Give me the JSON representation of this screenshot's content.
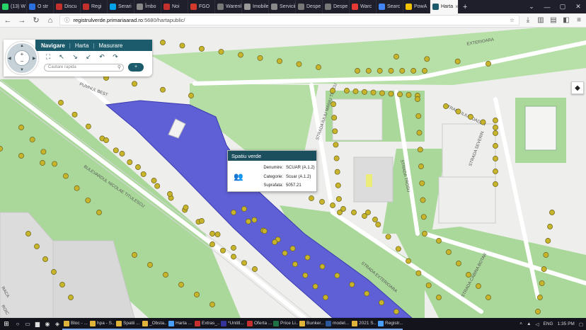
{
  "browser": {
    "tabs": [
      {
        "label": "(13) W",
        "color": "#25d366",
        "icon": "whatsapp-icon"
      },
      {
        "label": "O str",
        "color": "#2a6fdb",
        "icon": "site-icon"
      },
      {
        "label": "Discu",
        "color": "#c4302b",
        "icon": "youtube-icon"
      },
      {
        "label": "Regi",
        "color": "#c4302b",
        "icon": "site-icon"
      },
      {
        "label": "Serari",
        "color": "#00a2e8",
        "icon": "site-icon"
      },
      {
        "label": "Îmbo",
        "color": "#888888",
        "icon": "site-icon"
      },
      {
        "label": "Noi",
        "color": "#c4302b",
        "icon": "site-icon"
      },
      {
        "label": "FGO",
        "color": "#d33a2c",
        "icon": "site-icon"
      },
      {
        "label": "Warenko",
        "color": "#777777",
        "icon": "site-icon"
      },
      {
        "label": "Imobile",
        "color": "#999999",
        "icon": "site-icon"
      },
      {
        "label": "Servicii",
        "color": "#888888",
        "icon": "site-icon"
      },
      {
        "label": "Despe",
        "color": "#777777",
        "icon": "site-icon"
      },
      {
        "label": "Despe",
        "color": "#777777",
        "icon": "site-icon"
      },
      {
        "label": "Warc",
        "color": "#e53935",
        "icon": "site-icon"
      },
      {
        "label": "Searc",
        "color": "#4285f4",
        "icon": "google-icon"
      },
      {
        "label": "PowA",
        "color": "#f2c200",
        "icon": "site-icon"
      },
      {
        "label": "Harta",
        "color": "#1b5b6c",
        "icon": "site-icon",
        "active": true
      }
    ],
    "url_host": "registrulverde.primariaarad.ro",
    "url_path": ":5680/hartapublic/"
  },
  "nav_panel": {
    "tabs": [
      "Navigare",
      "Harta",
      "Masurare"
    ],
    "active_tab": "Navigare",
    "search_placeholder": "Cautare rapida",
    "go_label": "+"
  },
  "map": {
    "street_labels": [
      "BULEVARDUL NICOLAE TITULESCU",
      "STRADA EXTERIOARA",
      "STRADA ILIU YOADER",
      "STRADA TROSU",
      "STRADA SEVERIN",
      "STRADA CABINA BOTAR",
      "STRADA IULIU MANIU TESCU",
      "PUMNUL BEST",
      "EXTERIOARA",
      "RACA",
      "ROIC"
    ]
  },
  "popup": {
    "title": "Spatiu verde",
    "rows": [
      {
        "key": "Denumire:",
        "value": "SCUAR (A.1.2)"
      },
      {
        "key": "Categorie:",
        "value": "Scuar (A.1.2)"
      },
      {
        "key": "Suprafata:",
        "value": "5057.21"
      }
    ]
  },
  "taskbar": {
    "items": [
      {
        "label": "Bloc - ...",
        "color": "#e0b33a"
      },
      {
        "label": "hpa - S...",
        "color": "#e0b33a"
      },
      {
        "label": "Spatii ...",
        "color": "#e0b33a"
      },
      {
        "label": "_Obsta...",
        "color": "#e0b33a"
      },
      {
        "label": "Harta ...",
        "color": "#4aa0ff"
      },
      {
        "label": "Extras_...",
        "color": "#c4302b"
      },
      {
        "label": "*Untitl...",
        "color": "#333399"
      },
      {
        "label": "Oferta ...",
        "color": "#c4302b"
      },
      {
        "label": "Price Li...",
        "color": "#1e7145"
      },
      {
        "label": "Bunker...",
        "color": "#e0b33a"
      },
      {
        "label": "model...",
        "color": "#2b579a"
      },
      {
        "label": "2021 S...",
        "color": "#e0b33a"
      },
      {
        "label": "Registr...",
        "color": "#4aa0ff"
      }
    ],
    "language": "ENG",
    "time": "1:35 PM"
  },
  "colors": {
    "park_green": "#a9d89a",
    "selected_park": "#5f5fd6",
    "header_teal": "#1b5b6c",
    "tree_marker": "#c8b42a"
  }
}
